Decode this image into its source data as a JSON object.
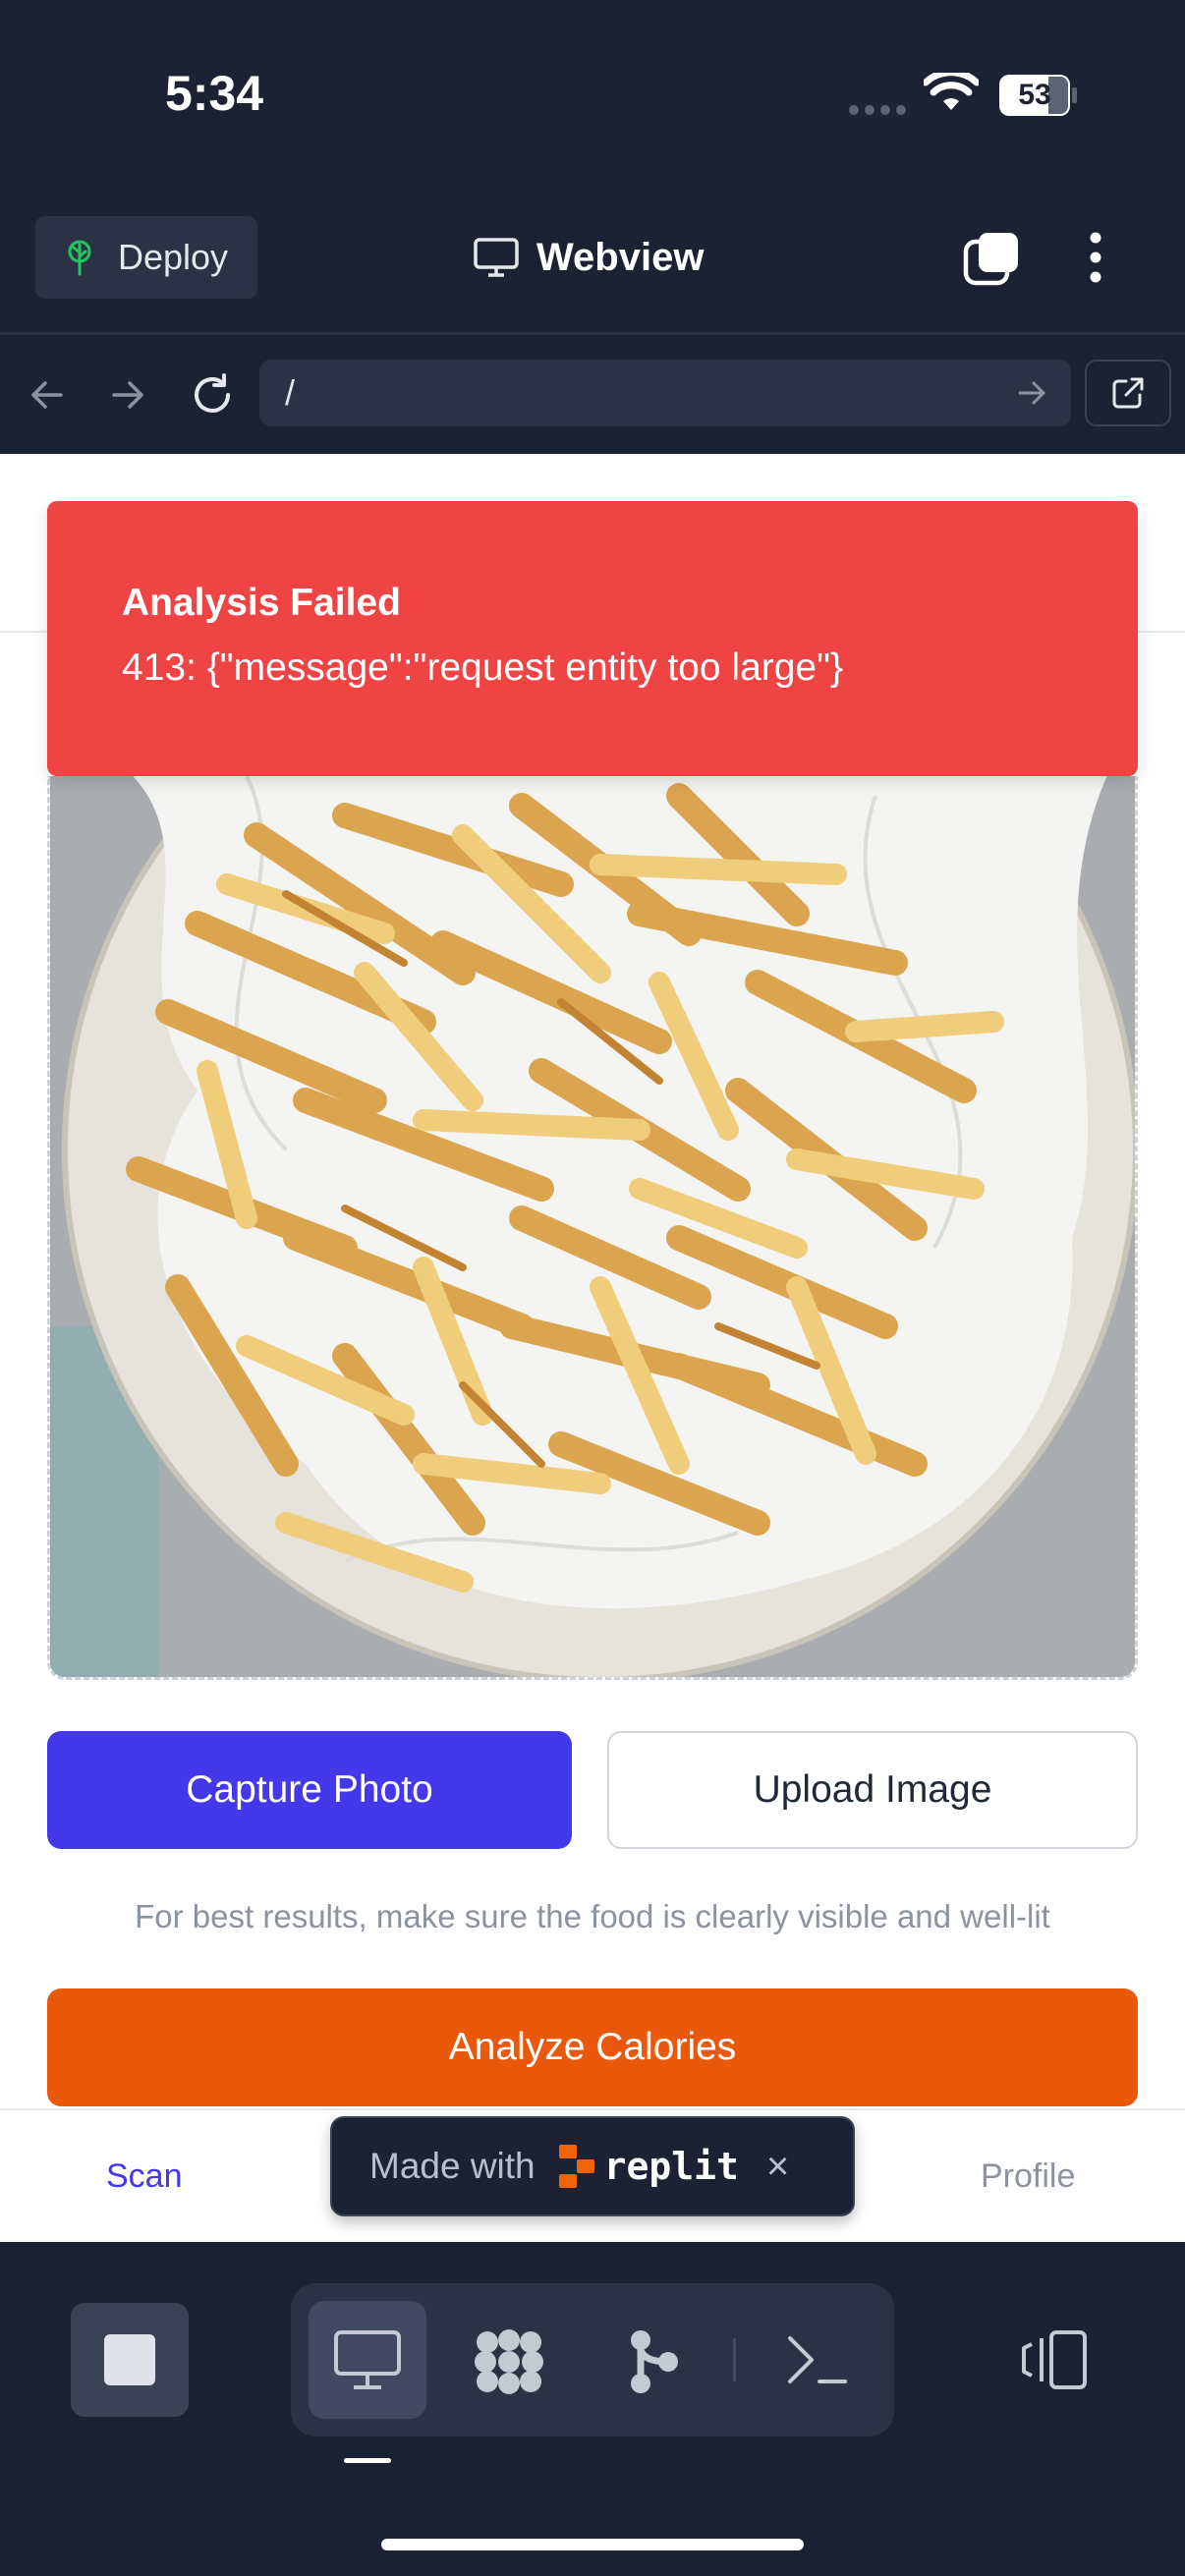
{
  "status_bar": {
    "time": "5:34",
    "battery": "53"
  },
  "header": {
    "deploy_label": "Deploy",
    "title": "Webview"
  },
  "url_bar": {
    "value": "/"
  },
  "toast": {
    "title": "Analysis Failed",
    "message": "413: {\"message\":\"request entity too large\"}"
  },
  "actions": {
    "capture_label": "Capture Photo",
    "upload_label": "Upload Image",
    "hint": "For best results, make sure the food is clearly visible and well-lit",
    "analyze_label": "Analyze Calories"
  },
  "bottom_nav": {
    "scan_label": "Scan",
    "profile_label": "Profile"
  },
  "badge": {
    "made_with_label": "Made with",
    "brand": "replit",
    "close_glyph": "×"
  },
  "colors": {
    "primary": "#4338ea",
    "analyze": "#ea580c",
    "error": "#ef4444",
    "chrome": "#1c2233"
  },
  "icons": [
    "deploy-tree-icon",
    "monitor-icon",
    "tabs-icon",
    "kebab-menu-icon",
    "back-arrow-icon",
    "forward-arrow-icon",
    "reload-icon",
    "go-arrow-icon",
    "open-external-icon",
    "stop-icon",
    "webview-icon",
    "apps-icon",
    "git-icon",
    "terminal-icon",
    "devices-icon"
  ]
}
